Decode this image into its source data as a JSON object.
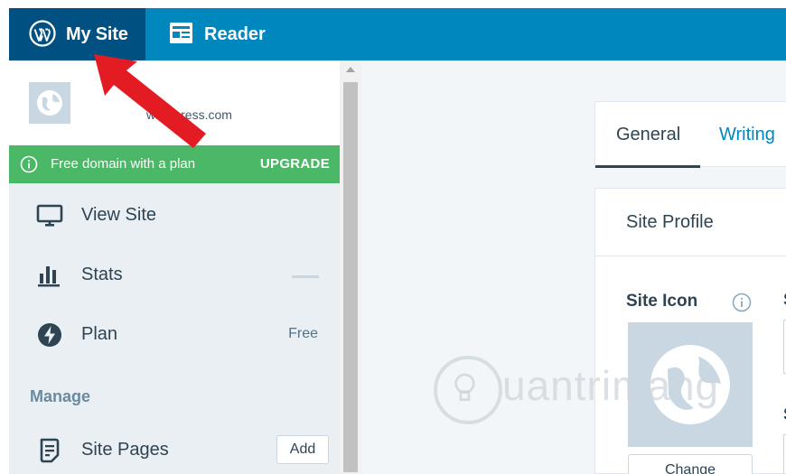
{
  "topbar": {
    "my_site_label": "My Site",
    "reader_label": "Reader"
  },
  "sidebar": {
    "site_url": "wordpress.com",
    "banner": {
      "text": "Free domain with a plan",
      "action": "UPGRADE"
    },
    "items": [
      {
        "label": "View Site",
        "icon": "monitor-icon"
      },
      {
        "label": "Stats",
        "icon": "stats-icon"
      },
      {
        "label": "Plan",
        "icon": "plan-icon",
        "badge": "Free"
      }
    ],
    "manage_heading": "Manage",
    "site_pages": {
      "label": "Site Pages",
      "icon": "page-icon",
      "button": "Add"
    }
  },
  "main": {
    "tabs": [
      {
        "label": "General",
        "active": true
      },
      {
        "label": "Writing",
        "active": false
      }
    ],
    "card_title": "Site Profile",
    "site_icon_label": "Site Icon",
    "change_button": "Change"
  },
  "watermark": {
    "text": "uantrimang"
  },
  "colors": {
    "topbar": "#0087be",
    "topbar_active": "#005082",
    "banner_green": "#4ab866",
    "sidebar_bg": "#e9eff3",
    "link_blue": "#0087be",
    "arrow_red": "#e31b23"
  }
}
